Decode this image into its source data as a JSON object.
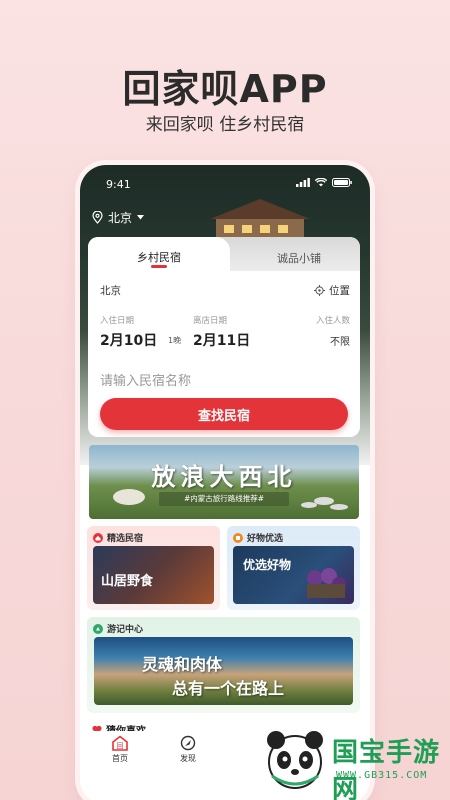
{
  "hero": {
    "title": "回家呗APP",
    "subtitle": "来回家呗 住乡村民宿"
  },
  "status_bar": {
    "time": "9:41"
  },
  "location": {
    "city": "北京"
  },
  "search_card": {
    "tabs": [
      {
        "label": "乡村民宿",
        "active": true
      },
      {
        "label": "诚品小铺",
        "active": false
      }
    ],
    "current_city": "北京",
    "position_label": "位置",
    "checkin_label": "入住日期",
    "checkin_date": "2月10日",
    "nights": "1晚",
    "checkout_label": "离店日期",
    "checkout_date": "2月11日",
    "guests_label": "入住人数",
    "guests_value": "不限",
    "search_placeholder": "请输入民宿名称",
    "search_button": "查找民宿"
  },
  "banner": {
    "title": "放浪大西北",
    "subtitle": "#内蒙古旅行路线推荐#"
  },
  "sections": {
    "featured_stays": {
      "label": "精选民宿",
      "image_text": "山居野食"
    },
    "good_products": {
      "label": "好物优选",
      "image_text": "优选好物"
    },
    "travel_center": {
      "label": "游记中心",
      "line1": "灵魂和肉体",
      "line2": "总有一个在路上"
    },
    "guess": {
      "label": "猜你喜欢"
    }
  },
  "bottom_nav": [
    {
      "label": "首页",
      "active": true
    },
    {
      "label": "发现",
      "active": false
    }
  ],
  "watermark": {
    "brand": "国宝手游网",
    "url": "WWW.GB315.COM"
  },
  "colors": {
    "accent": "#e3343a",
    "background": "#f8dada",
    "watermark": "#1f9e55"
  }
}
